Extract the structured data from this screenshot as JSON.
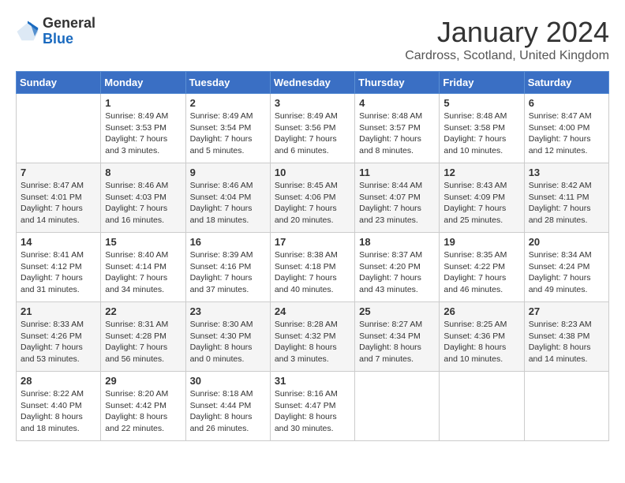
{
  "header": {
    "logo_general": "General",
    "logo_blue": "Blue",
    "month_title": "January 2024",
    "location": "Cardross, Scotland, United Kingdom"
  },
  "weekdays": [
    "Sunday",
    "Monday",
    "Tuesday",
    "Wednesday",
    "Thursday",
    "Friday",
    "Saturday"
  ],
  "weeks": [
    [
      {
        "day": "",
        "info": ""
      },
      {
        "day": "1",
        "info": "Sunrise: 8:49 AM\nSunset: 3:53 PM\nDaylight: 7 hours\nand 3 minutes."
      },
      {
        "day": "2",
        "info": "Sunrise: 8:49 AM\nSunset: 3:54 PM\nDaylight: 7 hours\nand 5 minutes."
      },
      {
        "day": "3",
        "info": "Sunrise: 8:49 AM\nSunset: 3:56 PM\nDaylight: 7 hours\nand 6 minutes."
      },
      {
        "day": "4",
        "info": "Sunrise: 8:48 AM\nSunset: 3:57 PM\nDaylight: 7 hours\nand 8 minutes."
      },
      {
        "day": "5",
        "info": "Sunrise: 8:48 AM\nSunset: 3:58 PM\nDaylight: 7 hours\nand 10 minutes."
      },
      {
        "day": "6",
        "info": "Sunrise: 8:47 AM\nSunset: 4:00 PM\nDaylight: 7 hours\nand 12 minutes."
      }
    ],
    [
      {
        "day": "7",
        "info": "Sunrise: 8:47 AM\nSunset: 4:01 PM\nDaylight: 7 hours\nand 14 minutes."
      },
      {
        "day": "8",
        "info": "Sunrise: 8:46 AM\nSunset: 4:03 PM\nDaylight: 7 hours\nand 16 minutes."
      },
      {
        "day": "9",
        "info": "Sunrise: 8:46 AM\nSunset: 4:04 PM\nDaylight: 7 hours\nand 18 minutes."
      },
      {
        "day": "10",
        "info": "Sunrise: 8:45 AM\nSunset: 4:06 PM\nDaylight: 7 hours\nand 20 minutes."
      },
      {
        "day": "11",
        "info": "Sunrise: 8:44 AM\nSunset: 4:07 PM\nDaylight: 7 hours\nand 23 minutes."
      },
      {
        "day": "12",
        "info": "Sunrise: 8:43 AM\nSunset: 4:09 PM\nDaylight: 7 hours\nand 25 minutes."
      },
      {
        "day": "13",
        "info": "Sunrise: 8:42 AM\nSunset: 4:11 PM\nDaylight: 7 hours\nand 28 minutes."
      }
    ],
    [
      {
        "day": "14",
        "info": "Sunrise: 8:41 AM\nSunset: 4:12 PM\nDaylight: 7 hours\nand 31 minutes."
      },
      {
        "day": "15",
        "info": "Sunrise: 8:40 AM\nSunset: 4:14 PM\nDaylight: 7 hours\nand 34 minutes."
      },
      {
        "day": "16",
        "info": "Sunrise: 8:39 AM\nSunset: 4:16 PM\nDaylight: 7 hours\nand 37 minutes."
      },
      {
        "day": "17",
        "info": "Sunrise: 8:38 AM\nSunset: 4:18 PM\nDaylight: 7 hours\nand 40 minutes."
      },
      {
        "day": "18",
        "info": "Sunrise: 8:37 AM\nSunset: 4:20 PM\nDaylight: 7 hours\nand 43 minutes."
      },
      {
        "day": "19",
        "info": "Sunrise: 8:35 AM\nSunset: 4:22 PM\nDaylight: 7 hours\nand 46 minutes."
      },
      {
        "day": "20",
        "info": "Sunrise: 8:34 AM\nSunset: 4:24 PM\nDaylight: 7 hours\nand 49 minutes."
      }
    ],
    [
      {
        "day": "21",
        "info": "Sunrise: 8:33 AM\nSunset: 4:26 PM\nDaylight: 7 hours\nand 53 minutes."
      },
      {
        "day": "22",
        "info": "Sunrise: 8:31 AM\nSunset: 4:28 PM\nDaylight: 7 hours\nand 56 minutes."
      },
      {
        "day": "23",
        "info": "Sunrise: 8:30 AM\nSunset: 4:30 PM\nDaylight: 8 hours\nand 0 minutes."
      },
      {
        "day": "24",
        "info": "Sunrise: 8:28 AM\nSunset: 4:32 PM\nDaylight: 8 hours\nand 3 minutes."
      },
      {
        "day": "25",
        "info": "Sunrise: 8:27 AM\nSunset: 4:34 PM\nDaylight: 8 hours\nand 7 minutes."
      },
      {
        "day": "26",
        "info": "Sunrise: 8:25 AM\nSunset: 4:36 PM\nDaylight: 8 hours\nand 10 minutes."
      },
      {
        "day": "27",
        "info": "Sunrise: 8:23 AM\nSunset: 4:38 PM\nDaylight: 8 hours\nand 14 minutes."
      }
    ],
    [
      {
        "day": "28",
        "info": "Sunrise: 8:22 AM\nSunset: 4:40 PM\nDaylight: 8 hours\nand 18 minutes."
      },
      {
        "day": "29",
        "info": "Sunrise: 8:20 AM\nSunset: 4:42 PM\nDaylight: 8 hours\nand 22 minutes."
      },
      {
        "day": "30",
        "info": "Sunrise: 8:18 AM\nSunset: 4:44 PM\nDaylight: 8 hours\nand 26 minutes."
      },
      {
        "day": "31",
        "info": "Sunrise: 8:16 AM\nSunset: 4:47 PM\nDaylight: 8 hours\nand 30 minutes."
      },
      {
        "day": "",
        "info": ""
      },
      {
        "day": "",
        "info": ""
      },
      {
        "day": "",
        "info": ""
      }
    ]
  ]
}
